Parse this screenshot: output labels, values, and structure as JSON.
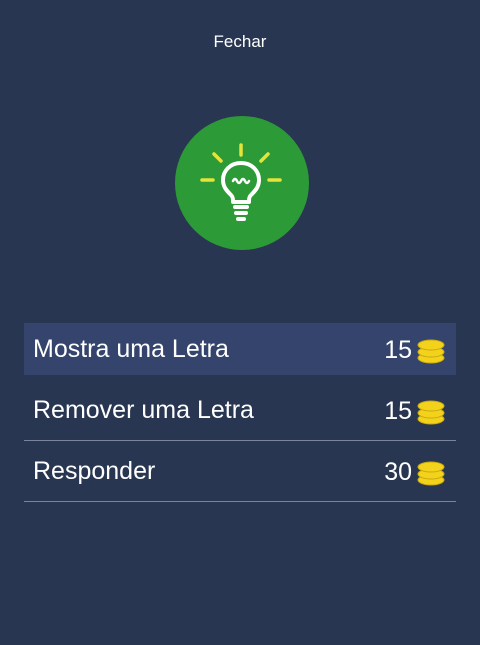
{
  "header": {
    "close_label": "Fechar"
  },
  "hint": {
    "icon": "lightbulb-icon",
    "circle_color": "#2c9a37",
    "ray_color": "#e6e33a"
  },
  "options": [
    {
      "label": "Mostra uma Letra",
      "cost": "15",
      "icon": "coins-icon",
      "selected": true
    },
    {
      "label": "Remover uma Letra",
      "cost": "15",
      "icon": "coins-icon",
      "selected": false
    },
    {
      "label": "Responder",
      "cost": "30",
      "icon": "coins-icon",
      "selected": false
    }
  ],
  "colors": {
    "background": "#283652",
    "selected_row": "#34446c",
    "coin": "#f3d21c"
  }
}
